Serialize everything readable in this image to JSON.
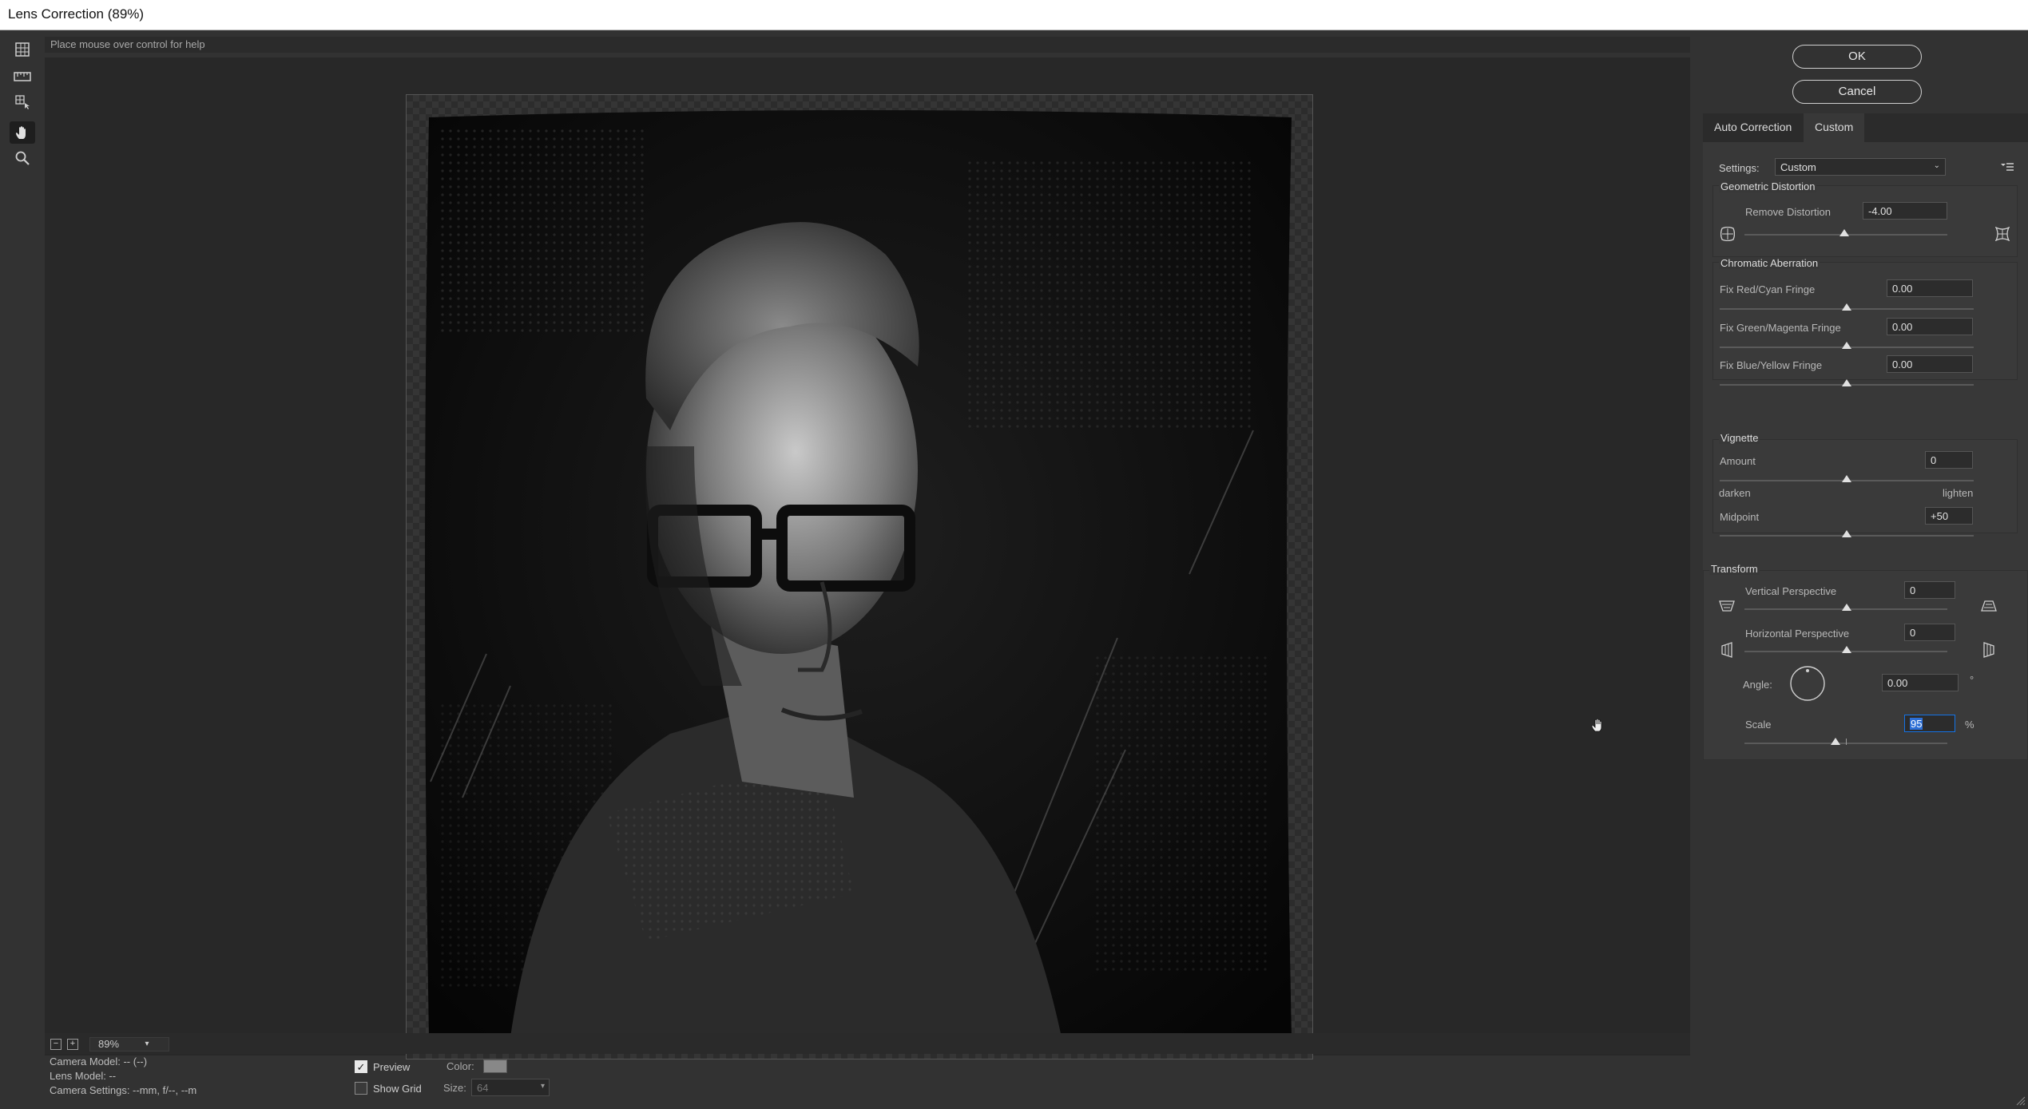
{
  "window": {
    "title": "Lens Correction (89%)"
  },
  "help_text": "Place mouse over control for help",
  "zoom": {
    "value": "89%"
  },
  "info": {
    "camera_model": "Camera Model: -- (--)",
    "lens_model": "Lens Model: --",
    "camera_settings": "Camera Settings: --mm, f/--, --m"
  },
  "view_options": {
    "preview_label": "Preview",
    "preview_checked": true,
    "show_grid_label": "Show Grid",
    "show_grid_checked": false,
    "color_label": "Color:",
    "color_value": "#888888",
    "size_label": "Size:",
    "size_value": "64"
  },
  "buttons": {
    "ok": "OK",
    "cancel": "Cancel"
  },
  "tabs": [
    {
      "label": "Auto Correction",
      "active": false
    },
    {
      "label": "Custom",
      "active": true
    }
  ],
  "settings": {
    "label": "Settings:",
    "value": "Custom"
  },
  "geometric": {
    "title": "Geometric Distortion",
    "remove_label": "Remove Distortion",
    "remove_value": "-4.00"
  },
  "chromatic": {
    "title": "Chromatic Aberration",
    "red_cyan_label": "Fix Red/Cyan Fringe",
    "red_cyan_value": "0.00",
    "green_magenta_label": "Fix Green/Magenta Fringe",
    "green_magenta_value": "0.00",
    "blue_yellow_label": "Fix Blue/Yellow Fringe",
    "blue_yellow_value": "0.00"
  },
  "vignette": {
    "title": "Vignette",
    "amount_label": "Amount",
    "amount_value": "0",
    "darken": "darken",
    "lighten": "lighten",
    "midpoint_label": "Midpoint",
    "midpoint_value": "+50"
  },
  "transform": {
    "title": "Transform",
    "vertical_label": "Vertical Perspective",
    "vertical_value": "0",
    "horizontal_label": "Horizontal Perspective",
    "horizontal_value": "0",
    "angle_label": "Angle:",
    "angle_value": "0.00",
    "angle_unit": "°",
    "scale_label": "Scale",
    "scale_value": "95",
    "scale_unit": "%"
  }
}
